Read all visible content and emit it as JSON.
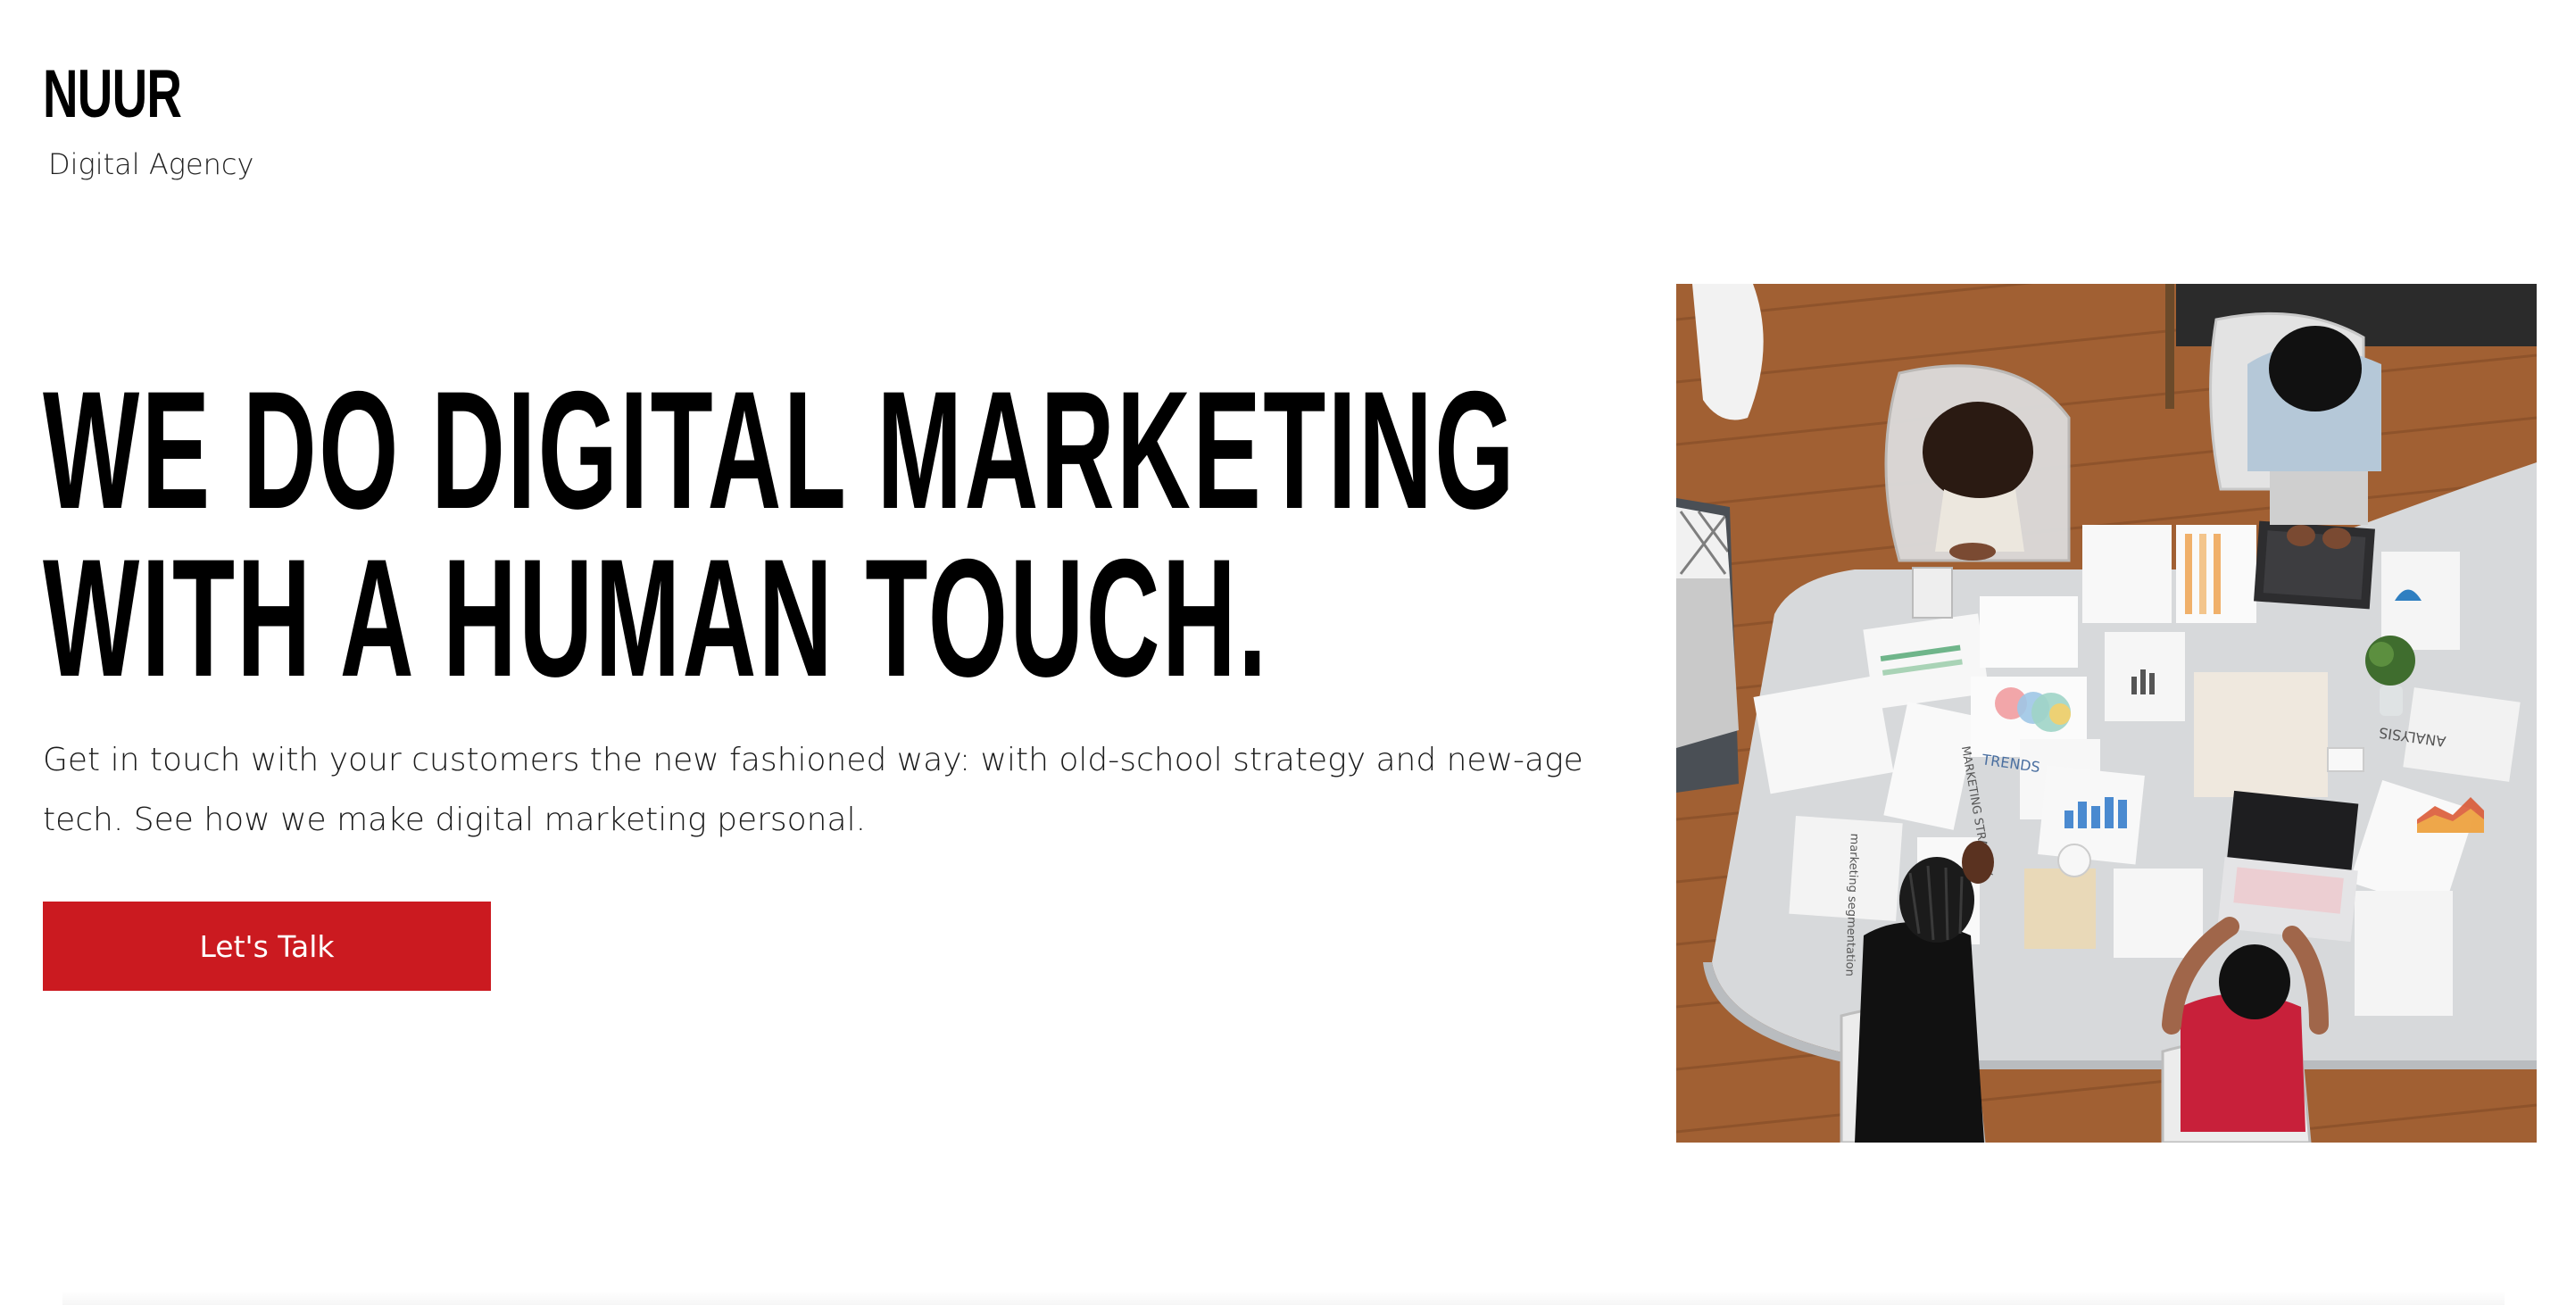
{
  "brand": {
    "name": "NUUR",
    "tagline": "Digital Agency"
  },
  "hero": {
    "headline_line1": "WE DO DIGITAL MARKETING",
    "headline_line2": "WITH A HUMAN TOUCH.",
    "subtext": "Get in touch with your customers the new fashioned way: with old-school strategy and new-age tech. See how we make digital marketing personal.",
    "cta_label": "Let's Talk"
  },
  "photo": {
    "paper_labels": {
      "marketing_strategy": "MARKETING STRATEGY",
      "trends": "TRENDS",
      "analysis": "ANALYSIS",
      "segmentation": "marketing segmentation"
    }
  },
  "colors": {
    "accent": "#cb1a20",
    "text": "#000000",
    "background": "#ffffff"
  }
}
